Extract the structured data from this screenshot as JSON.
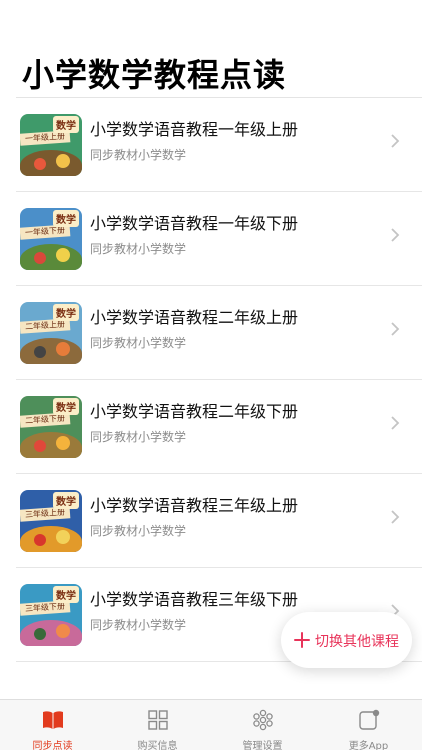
{
  "page_title": "小学数学教程点读",
  "courses": [
    {
      "title": "小学数学语音教程一年级上册",
      "subtitle": "同步教材小学数学",
      "cover_tag": "数学",
      "cover_grade": "一年级上册",
      "bg": "#3f9a6a",
      "hill": "#7a5a2e",
      "kid1": "#e8583c",
      "kid2": "#f2c14a"
    },
    {
      "title": "小学数学语音教程一年级下册",
      "subtitle": "同步教材小学数学",
      "cover_tag": "数学",
      "cover_grade": "一年级下册",
      "bg": "#4b8fc9",
      "hill": "#5a8a3a",
      "kid1": "#d9483a",
      "kid2": "#f0d04a"
    },
    {
      "title": "小学数学语音教程二年级上册",
      "subtitle": "同步教材小学数学",
      "cover_tag": "数学",
      "cover_grade": "二年级上册",
      "bg": "#6aa9cf",
      "hill": "#8c6a3c",
      "kid1": "#444444",
      "kid2": "#e67c3a"
    },
    {
      "title": "小学数学语音教程二年级下册",
      "subtitle": "同步教材小学数学",
      "cover_tag": "数学",
      "cover_grade": "二年级下册",
      "bg": "#4e8f5a",
      "hill": "#9a7a3a",
      "kid1": "#e0483a",
      "kid2": "#f4b33c"
    },
    {
      "title": "小学数学语音教程三年级上册",
      "subtitle": "同步教材小学数学",
      "cover_tag": "数学",
      "cover_grade": "三年级上册",
      "bg": "#2f5fa8",
      "hill": "#e29a2a",
      "kid1": "#d8362c",
      "kid2": "#f2d25a"
    },
    {
      "title": "小学数学语音教程三年级下册",
      "subtitle": "同步教材小学数学",
      "cover_tag": "数学",
      "cover_grade": "三年级下册",
      "bg": "#3a9ac4",
      "hill": "#c86a9a",
      "kid1": "#3a6a3a",
      "kid2": "#f08a4a"
    }
  ],
  "fab": {
    "label": "切换其他课程",
    "icon": "plus-icon",
    "color": "#e8345a"
  },
  "tabbar": {
    "active_color": "#e23b1e",
    "items": [
      {
        "label": "同步点读",
        "icon": "book-icon"
      },
      {
        "label": "购买信息",
        "icon": "grid-icon"
      },
      {
        "label": "管理设置",
        "icon": "flower-settings-icon"
      },
      {
        "label": "更多App",
        "icon": "app-badge-icon"
      }
    ]
  }
}
